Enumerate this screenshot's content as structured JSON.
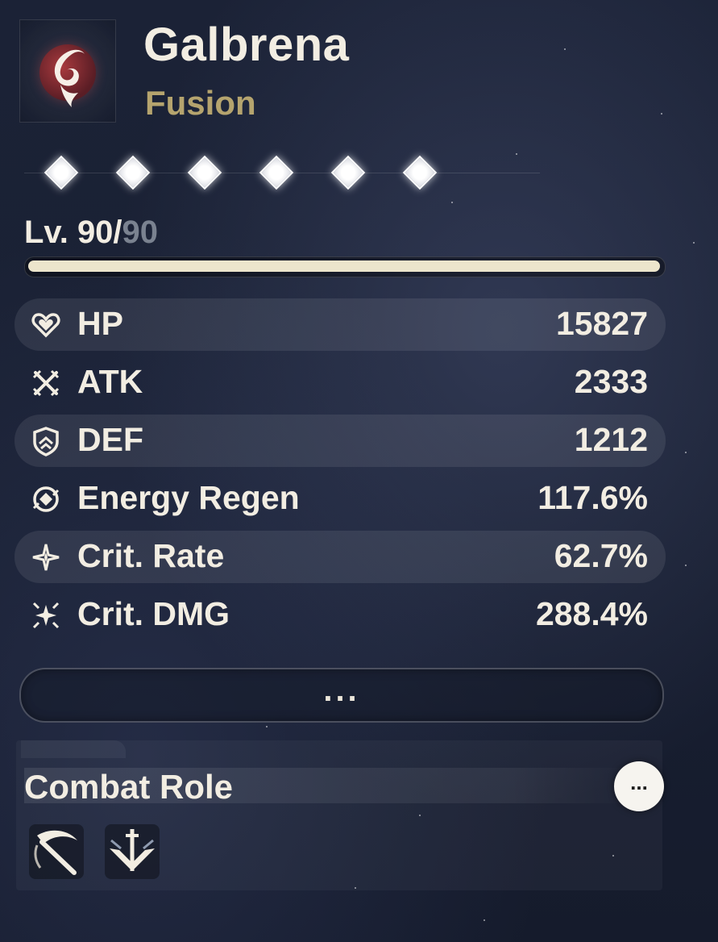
{
  "character": {
    "name": "Galbrena",
    "element": "Fusion",
    "element_icon": "fusion-flame-icon"
  },
  "sequence": {
    "unlocked": 6,
    "total": 6,
    "node_icon": "diamond-icon"
  },
  "level": {
    "current": "Lv. 90/",
    "max": "90",
    "progress": 1.0
  },
  "stats": [
    {
      "label": "HP",
      "value": "15827",
      "icon": "heart-icon"
    },
    {
      "label": "ATK",
      "value": "2333",
      "icon": "crossed-swords-icon"
    },
    {
      "label": "DEF",
      "value": "1212",
      "icon": "shield-icon"
    },
    {
      "label": "Energy Regen",
      "value": "117.6%",
      "icon": "energy-regen-icon"
    },
    {
      "label": "Crit. Rate",
      "value": "62.7%",
      "icon": "sparkle-icon"
    },
    {
      "label": "Crit. DMG",
      "value": "288.4%",
      "icon": "burst-sparkle-icon"
    }
  ],
  "more_button": {
    "label": "..."
  },
  "combat_role": {
    "title": "Combat Role",
    "more_label": "...",
    "roles": [
      {
        "icon": "scythe-blade-icon"
      },
      {
        "icon": "downward-sword-icon"
      }
    ]
  },
  "colors": {
    "element_accent": "#b5a46e",
    "text": "#f2ede2",
    "level_max": "#7a8290",
    "level_fill": "#ece5cc"
  }
}
